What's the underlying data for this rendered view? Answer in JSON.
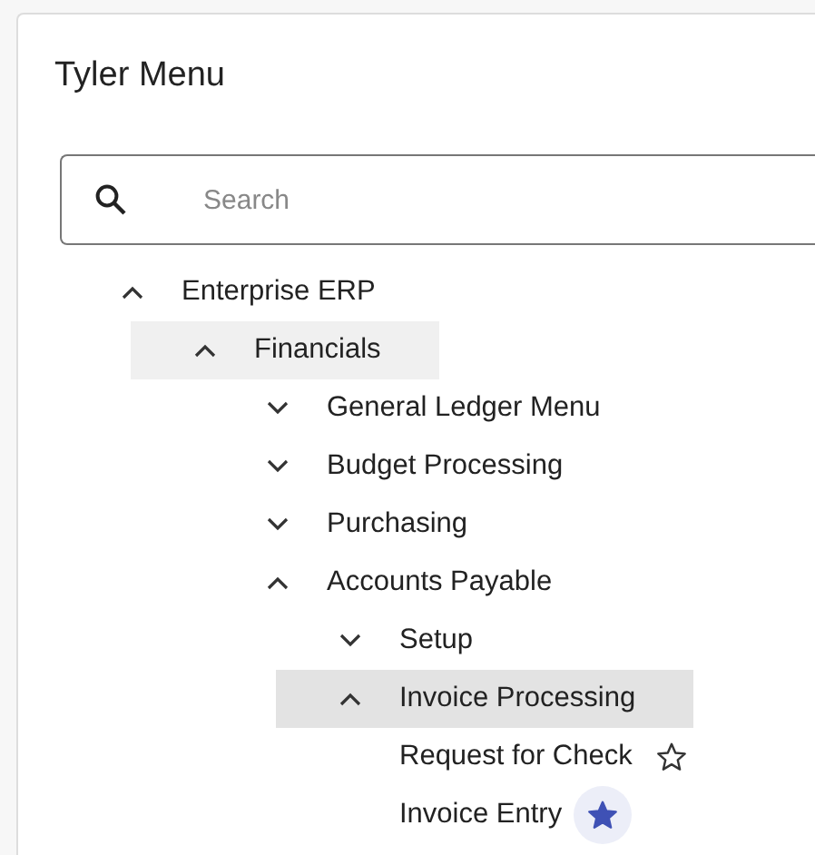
{
  "title": "Tyler Menu",
  "search": {
    "placeholder": "Search"
  },
  "tree": [
    {
      "label": "Enterprise ERP",
      "expanded": true,
      "selected": false,
      "children": [
        {
          "label": "Financials",
          "expanded": true,
          "selected": true,
          "children": [
            {
              "label": "General Ledger Menu",
              "expanded": false,
              "selected": false
            },
            {
              "label": "Budget Processing",
              "expanded": false,
              "selected": false
            },
            {
              "label": "Purchasing",
              "expanded": false,
              "selected": false
            },
            {
              "label": "Accounts Payable",
              "expanded": true,
              "selected": false,
              "children": [
                {
                  "label": "Setup",
                  "expanded": false,
                  "selected": false
                },
                {
                  "label": "Invoice Processing",
                  "expanded": true,
                  "selected": true,
                  "children": [
                    {
                      "label": "Request for Check",
                      "kind": "leaf",
                      "favorite": false,
                      "selected": false
                    },
                    {
                      "label": "Invoice Entry",
                      "kind": "leaf",
                      "favorite": true,
                      "selected": false
                    }
                  ]
                }
              ]
            }
          ]
        }
      ]
    }
  ]
}
